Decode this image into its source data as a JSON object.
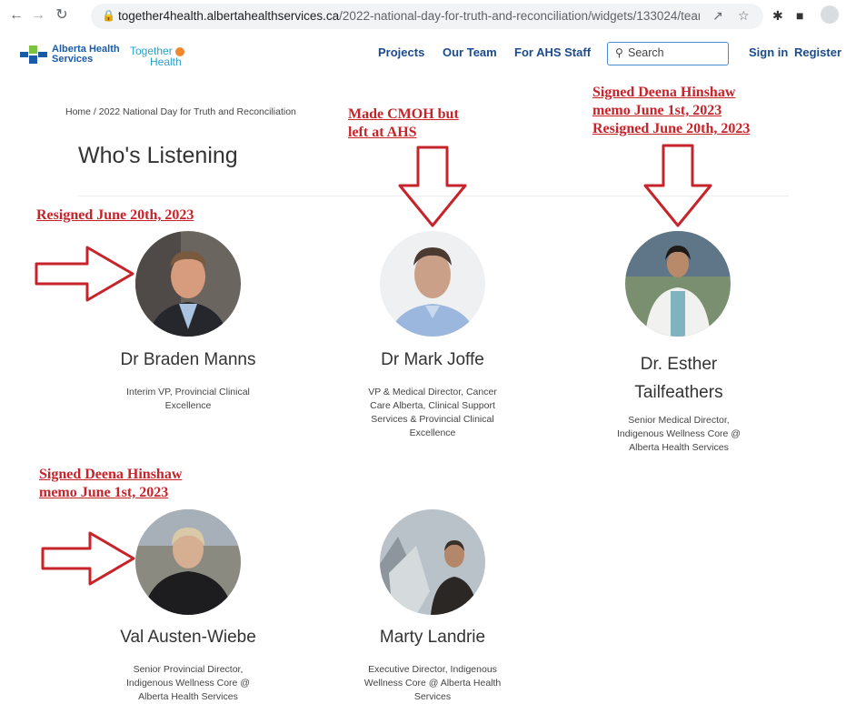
{
  "browser": {
    "url_domain": "together4health.albertahealthservices.ca",
    "url_path": "/2022-national-day-for-truth-and-reconciliation/widgets/133024/team_me...",
    "icons": [
      "back-icon",
      "forward-icon",
      "reload-icon",
      "lock-icon",
      "share-icon",
      "star-icon",
      "extensions-icon",
      "sidepanel-icon",
      "profile-icon"
    ]
  },
  "header": {
    "ahs_line1": "Alberta Health",
    "ahs_line2": "Services",
    "together_line1": "Together",
    "together_line2": "Health",
    "nav": {
      "projects": "Projects",
      "team": "Our Team",
      "staff": "For AHS Staff"
    },
    "search_placeholder": "Search",
    "sign_in": "Sign in",
    "register": "Register"
  },
  "page": {
    "breadcrumb": "Home  /  2022 National Day for Truth and Reconciliation",
    "title": "Who's Listening"
  },
  "team": [
    {
      "name": "Dr Braden Manns",
      "role_lines": [
        "Interim VP, Provincial Clinical",
        "Excellence"
      ]
    },
    {
      "name": "Dr Mark Joffe",
      "role_lines": [
        "VP & Medical Director, Cancer",
        "Care Alberta, Clinical Support",
        "Services & Provincial Clinical",
        "Excellence"
      ]
    },
    {
      "name_lines": [
        "Dr. Esther",
        "Tailfeathers"
      ],
      "role_lines": [
        "Senior Medical Director,",
        "Indigenous Wellness Core @",
        "Alberta Health Services"
      ]
    },
    {
      "name": "Val Austen-Wiebe",
      "role_lines": [
        "Senior Provincial Director,",
        "Indigenous Wellness Core @",
        "Alberta Health Services"
      ]
    },
    {
      "name": "Marty Landrie",
      "role_lines": [
        "Executive Director, Indigenous",
        "Wellness Core @ Alberta Health",
        "Services"
      ]
    }
  ],
  "annotations": {
    "manns": "Resigned June 20th, 2023",
    "joffe": [
      "Made CMOH but",
      "left at AHS"
    ],
    "tailfeathers": [
      "Signed Deena Hinshaw",
      "memo June 1st, 2023",
      "Resigned June 20th, 2023"
    ],
    "austen_wiebe": [
      "Signed Deena Hinshaw",
      "memo June 1st, 2023"
    ]
  },
  "colors": {
    "annotation_red": "#c6232a",
    "nav_blue": "#1a4b8c",
    "ahs_blue": "#1a5aa6",
    "ahs_green": "#7cc242"
  }
}
